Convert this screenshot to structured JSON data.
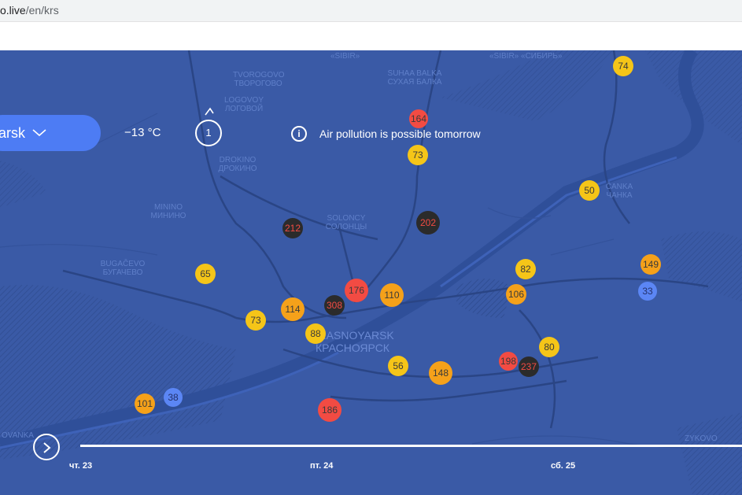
{
  "browser": {
    "url_host": "o.live",
    "url_path": "/en/krs"
  },
  "header": {
    "city": "arsk",
    "temperature": "−13 °C",
    "forecast_days": "1",
    "alert_text": "Air pollution is possible tomorrow"
  },
  "map_labels": [
    {
      "name": "sibir-label-1",
      "text": "«SIBIR»"
    },
    {
      "name": "sibir-label-2",
      "text": "«SIBIR» «СИБИРЬ»"
    },
    {
      "name": "tvorogovo",
      "text": "TVOROGOVO ТВОРОГОВО"
    },
    {
      "name": "sukhaya-balka",
      "text": "SUHAA BALKA СУХАЯ БАЛКА"
    },
    {
      "name": "logovoy",
      "text": "LOGOVOY ЛОГОВОЙ"
    },
    {
      "name": "drokino",
      "text": "DROKINO ДРОКИНО"
    },
    {
      "name": "minino",
      "text": "MININO МИНИНО"
    },
    {
      "name": "solontsy",
      "text": "SOLONCY СОЛОНЦЫ"
    },
    {
      "name": "bugachevo",
      "text": "BUGAČEVO БУГАЧЕВО"
    },
    {
      "name": "krasnoyarsk",
      "text": "KRASNOYARSK КРАСНОЯРСК"
    },
    {
      "name": "sanka",
      "text": "ČANKA ЧАНКА"
    },
    {
      "name": "zykovo",
      "text": "ZYKOVO"
    },
    {
      "name": "ovanka",
      "text": "OVANKA"
    }
  ],
  "markers": [
    {
      "value": "74",
      "level": "yellow"
    },
    {
      "value": "164",
      "level": "red"
    },
    {
      "value": "73",
      "level": "yellow"
    },
    {
      "value": "50",
      "level": "yellow"
    },
    {
      "value": "212",
      "level": "dark"
    },
    {
      "value": "202",
      "level": "dark"
    },
    {
      "value": "149",
      "level": "orange"
    },
    {
      "value": "82",
      "level": "yellow"
    },
    {
      "value": "65",
      "level": "yellow"
    },
    {
      "value": "33",
      "level": "blue"
    },
    {
      "value": "176",
      "level": "red"
    },
    {
      "value": "110",
      "level": "orange"
    },
    {
      "value": "106",
      "level": "orange"
    },
    {
      "value": "114",
      "level": "orange"
    },
    {
      "value": "308",
      "level": "dark"
    },
    {
      "value": "73",
      "level": "yellow"
    },
    {
      "value": "88",
      "level": "yellow"
    },
    {
      "value": "80",
      "level": "yellow"
    },
    {
      "value": "198",
      "level": "red"
    },
    {
      "value": "237",
      "level": "dark"
    },
    {
      "value": "56",
      "level": "yellow"
    },
    {
      "value": "148",
      "level": "orange"
    },
    {
      "value": "101",
      "level": "orange"
    },
    {
      "value": "38",
      "level": "blue"
    },
    {
      "value": "186",
      "level": "red"
    }
  ],
  "timeline": {
    "ticks": [
      "чт. 23",
      "пт. 24",
      "сб. 25"
    ]
  },
  "colors": {
    "map_bg": "#3a5aa6",
    "river": "#2f4f99",
    "pill": "#4d7cf4",
    "yellow": "#f5c518",
    "orange": "#f5a11a",
    "red": "#f24b43",
    "dark": "#2b2b2b",
    "blue": "#5b86f5"
  },
  "icons": {
    "info": "info-circle-icon",
    "chevron": "chevron-down-icon",
    "play": "play-arrow-icon"
  }
}
